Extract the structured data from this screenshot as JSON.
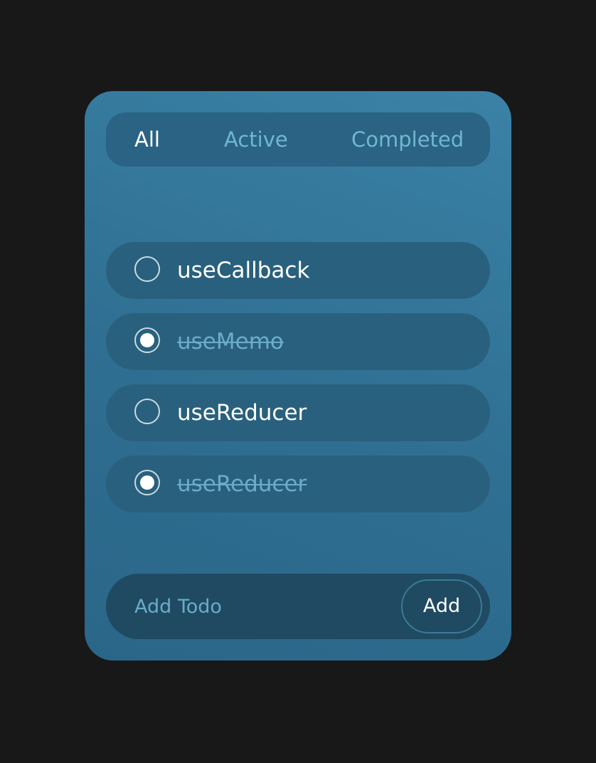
{
  "tabs": [
    {
      "label": "All",
      "active": true
    },
    {
      "label": "Active",
      "active": false
    },
    {
      "label": "Completed",
      "active": false
    }
  ],
  "todos": [
    {
      "text": "useCallback",
      "completed": false
    },
    {
      "text": "useMemo",
      "completed": true
    },
    {
      "text": "useReducer",
      "completed": false
    },
    {
      "text": "useReducer",
      "completed": true
    }
  ],
  "add_todo": {
    "placeholder": "Add Todo",
    "value": "",
    "button_label": "Add"
  },
  "colors": {
    "background": "#181818",
    "card": "#3a82a6",
    "pill": "#29607d",
    "input_bar": "#1f4a62",
    "accent_text": "#72b6d2",
    "active_text": "#ffffff"
  }
}
